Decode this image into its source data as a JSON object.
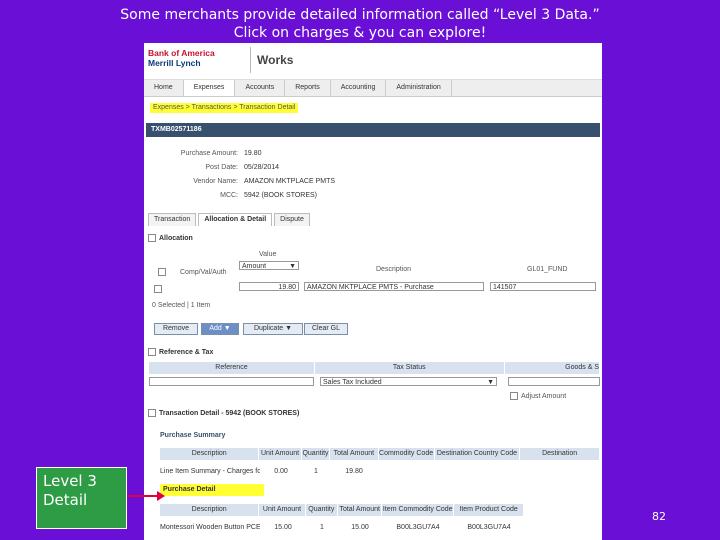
{
  "slide": {
    "title_line1": "Some merchants provide detailed information called “Level 3 Data.”",
    "title_line2": "Click on charges & you can explore!",
    "callout": "Level 3 Detail",
    "page_number": "82"
  },
  "header": {
    "logo_line1": "Bank of America",
    "logo_line2": "Merrill Lynch",
    "product": "Works"
  },
  "nav": {
    "items": [
      "Home",
      "Expenses",
      "Accounts",
      "Reports",
      "Accounting",
      "Administration"
    ]
  },
  "breadcrumb": "Expenses > Transactions > Transaction Detail",
  "transaction": {
    "id": "TXMB02571186",
    "fields": [
      {
        "label": "Purchase Amount:",
        "value": "19.80"
      },
      {
        "label": "Post Date:",
        "value": "05/28/2014"
      },
      {
        "label": "Vendor Name:",
        "value": "AMAZON MKTPLACE PMTS"
      },
      {
        "label": "MCC:",
        "value": "5942 (BOOK STORES)"
      }
    ]
  },
  "tabs": [
    "Transaction",
    "Allocation & Detail",
    "Dispute"
  ],
  "allocation": {
    "section_title": "Allocation",
    "value_label": "Value",
    "value_select": "Amount",
    "col_comp": "Comp/Val/Auth",
    "col_description": "Description",
    "col_gl": "GL01_FUND",
    "amount": "19.80",
    "description": "AMAZON MKTPLACE PMTS - Purchase",
    "gl_value": "141507",
    "selected_text": "0 Selected | 1 Item",
    "buttons": [
      "Remove",
      "Add ▼",
      "Duplicate ▼",
      "Clear GL"
    ]
  },
  "ref_tax": {
    "section_title": "Reference & Tax",
    "col_reference": "Reference",
    "col_tax_status": "Tax Status",
    "col_goods": "Goods & S",
    "tax_status_value": "Sales Tax Included",
    "adjust_amount": "Adjust Amount"
  },
  "detail": {
    "section_title": "Transaction Detail - 5942 (BOOK STORES)",
    "summary_title": "Purchase Summary",
    "summary_headers": [
      "Description",
      "Unit Amount",
      "Quantity",
      "Total Amount",
      "Commodity Code",
      "Destination Country Code",
      "Destination"
    ],
    "summary_row": [
      "Line Item Summary - Charges for 05/28/14",
      "0.00",
      "1",
      "19.80",
      "",
      "",
      ""
    ],
    "purchase_detail_title": "Purchase Detail",
    "detail_headers": [
      "Description",
      "Unit Amount",
      "Quantity",
      "Total Amount",
      "Item Commodity Code",
      "Item Product Code"
    ],
    "detail_row": [
      "Montessori Wooden Button PCE",
      "15.00",
      "1",
      "15.00",
      "B00L3GU7A4",
      "B00L3GU7A4"
    ]
  }
}
